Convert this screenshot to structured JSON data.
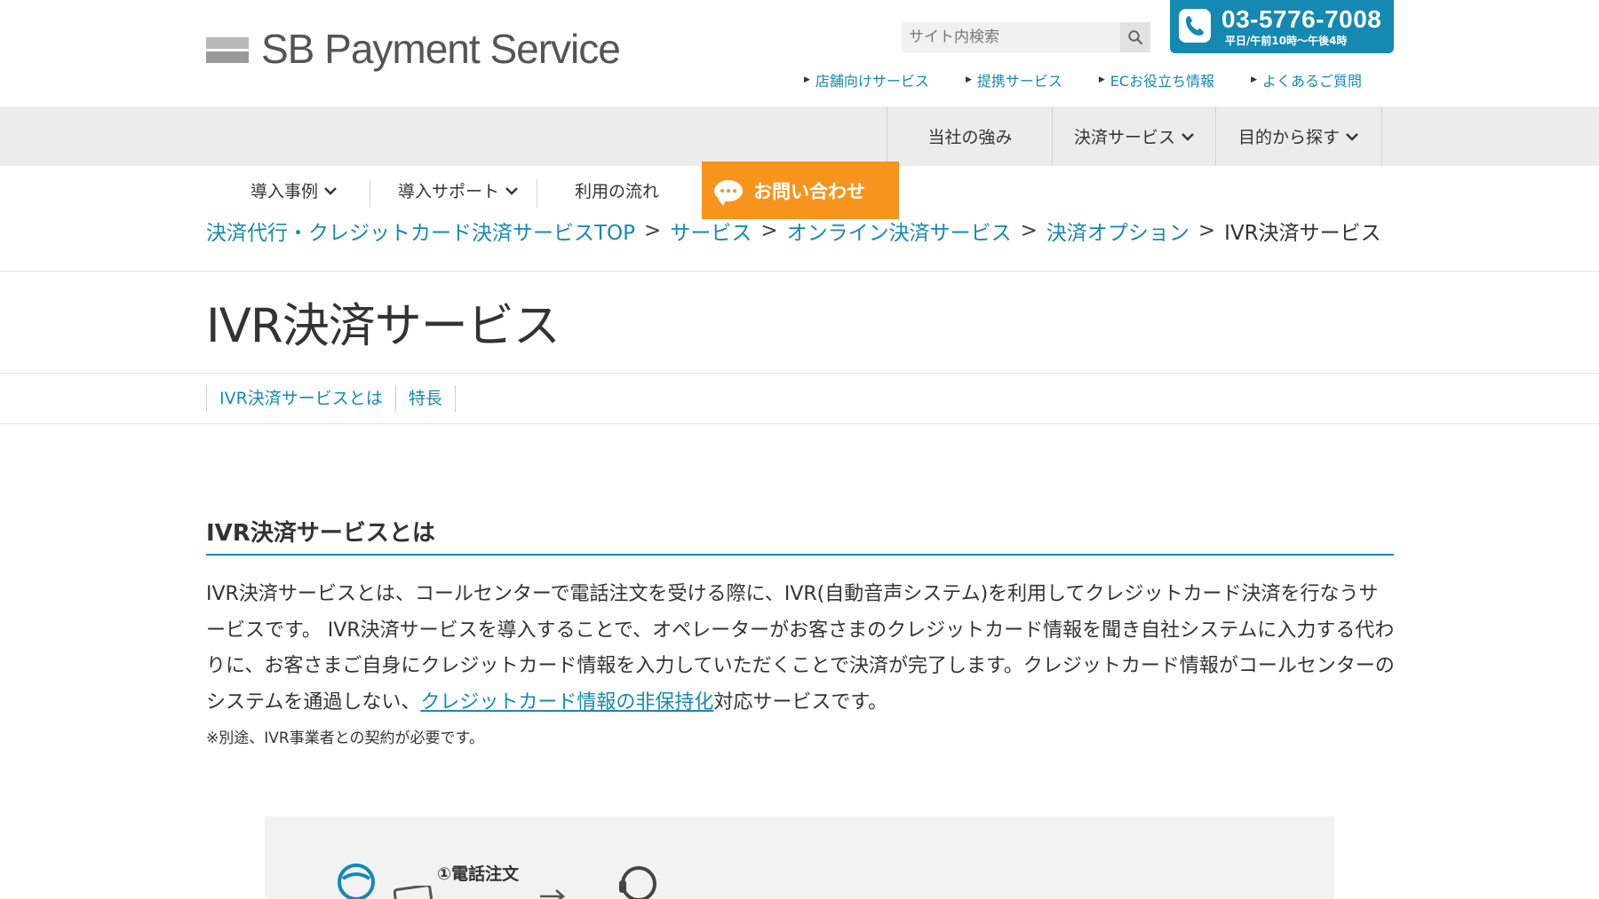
{
  "header": {
    "logo_text": "SB Payment Service",
    "search_placeholder": "サイト内検索",
    "phone_number": "03-5776-7008",
    "phone_hours": "平日/午前10時～午後4時",
    "sublinks": [
      {
        "label": "店舗向けサービス"
      },
      {
        "label": "提携サービス"
      },
      {
        "label": "ECお役立ち情報"
      },
      {
        "label": "よくあるご質問"
      }
    ]
  },
  "main_nav": [
    {
      "label": "当社の強み"
    },
    {
      "label": "決済サービス"
    },
    {
      "label": "目的から探す"
    }
  ],
  "sub_nav": [
    {
      "label": "導入事例"
    },
    {
      "label": "導入サポート"
    },
    {
      "label": "利用の流れ"
    }
  ],
  "contact_label": "お問い合わせ",
  "breadcrumb": {
    "items": [
      "決済代行・クレジットカード決済サービスTOP",
      "サービス",
      "オンライン決済サービス",
      "決済オプション"
    ],
    "current": "IVR決済サービス",
    "separator": ">"
  },
  "page_title": "IVR決済サービス",
  "anchor_nav": [
    {
      "label": "IVR決済サービスとは"
    },
    {
      "label": "特長"
    }
  ],
  "section": {
    "title": "IVR決済サービスとは",
    "para_text_1": "IVR決済サービスとは、コールセンターで電話注文を受ける際に、IVR(自動音声システム)を利用してクレジットカード決済を行なうサービスです。 IVR決済サービスを導入することで、オペレーターがお客さまのクレジットカード情報を聞き自社システムに入力する代わりに、お客さまご自身にクレジットカード情報を入力していただくことで決済が完了します。クレジットカード情報がコールセンターのシステムを通過しない、",
    "para_link": "クレジットカード情報の非保持化",
    "para_text_2": "対応サービスです。",
    "note": "※別途、IVR事業者との契約が必要です。"
  },
  "diagram": {
    "step1_label": "①電話注文"
  },
  "colors": {
    "brand_blue": "#1589b1",
    "contact_orange": "#f7941d",
    "nav_gray": "#ececec"
  }
}
